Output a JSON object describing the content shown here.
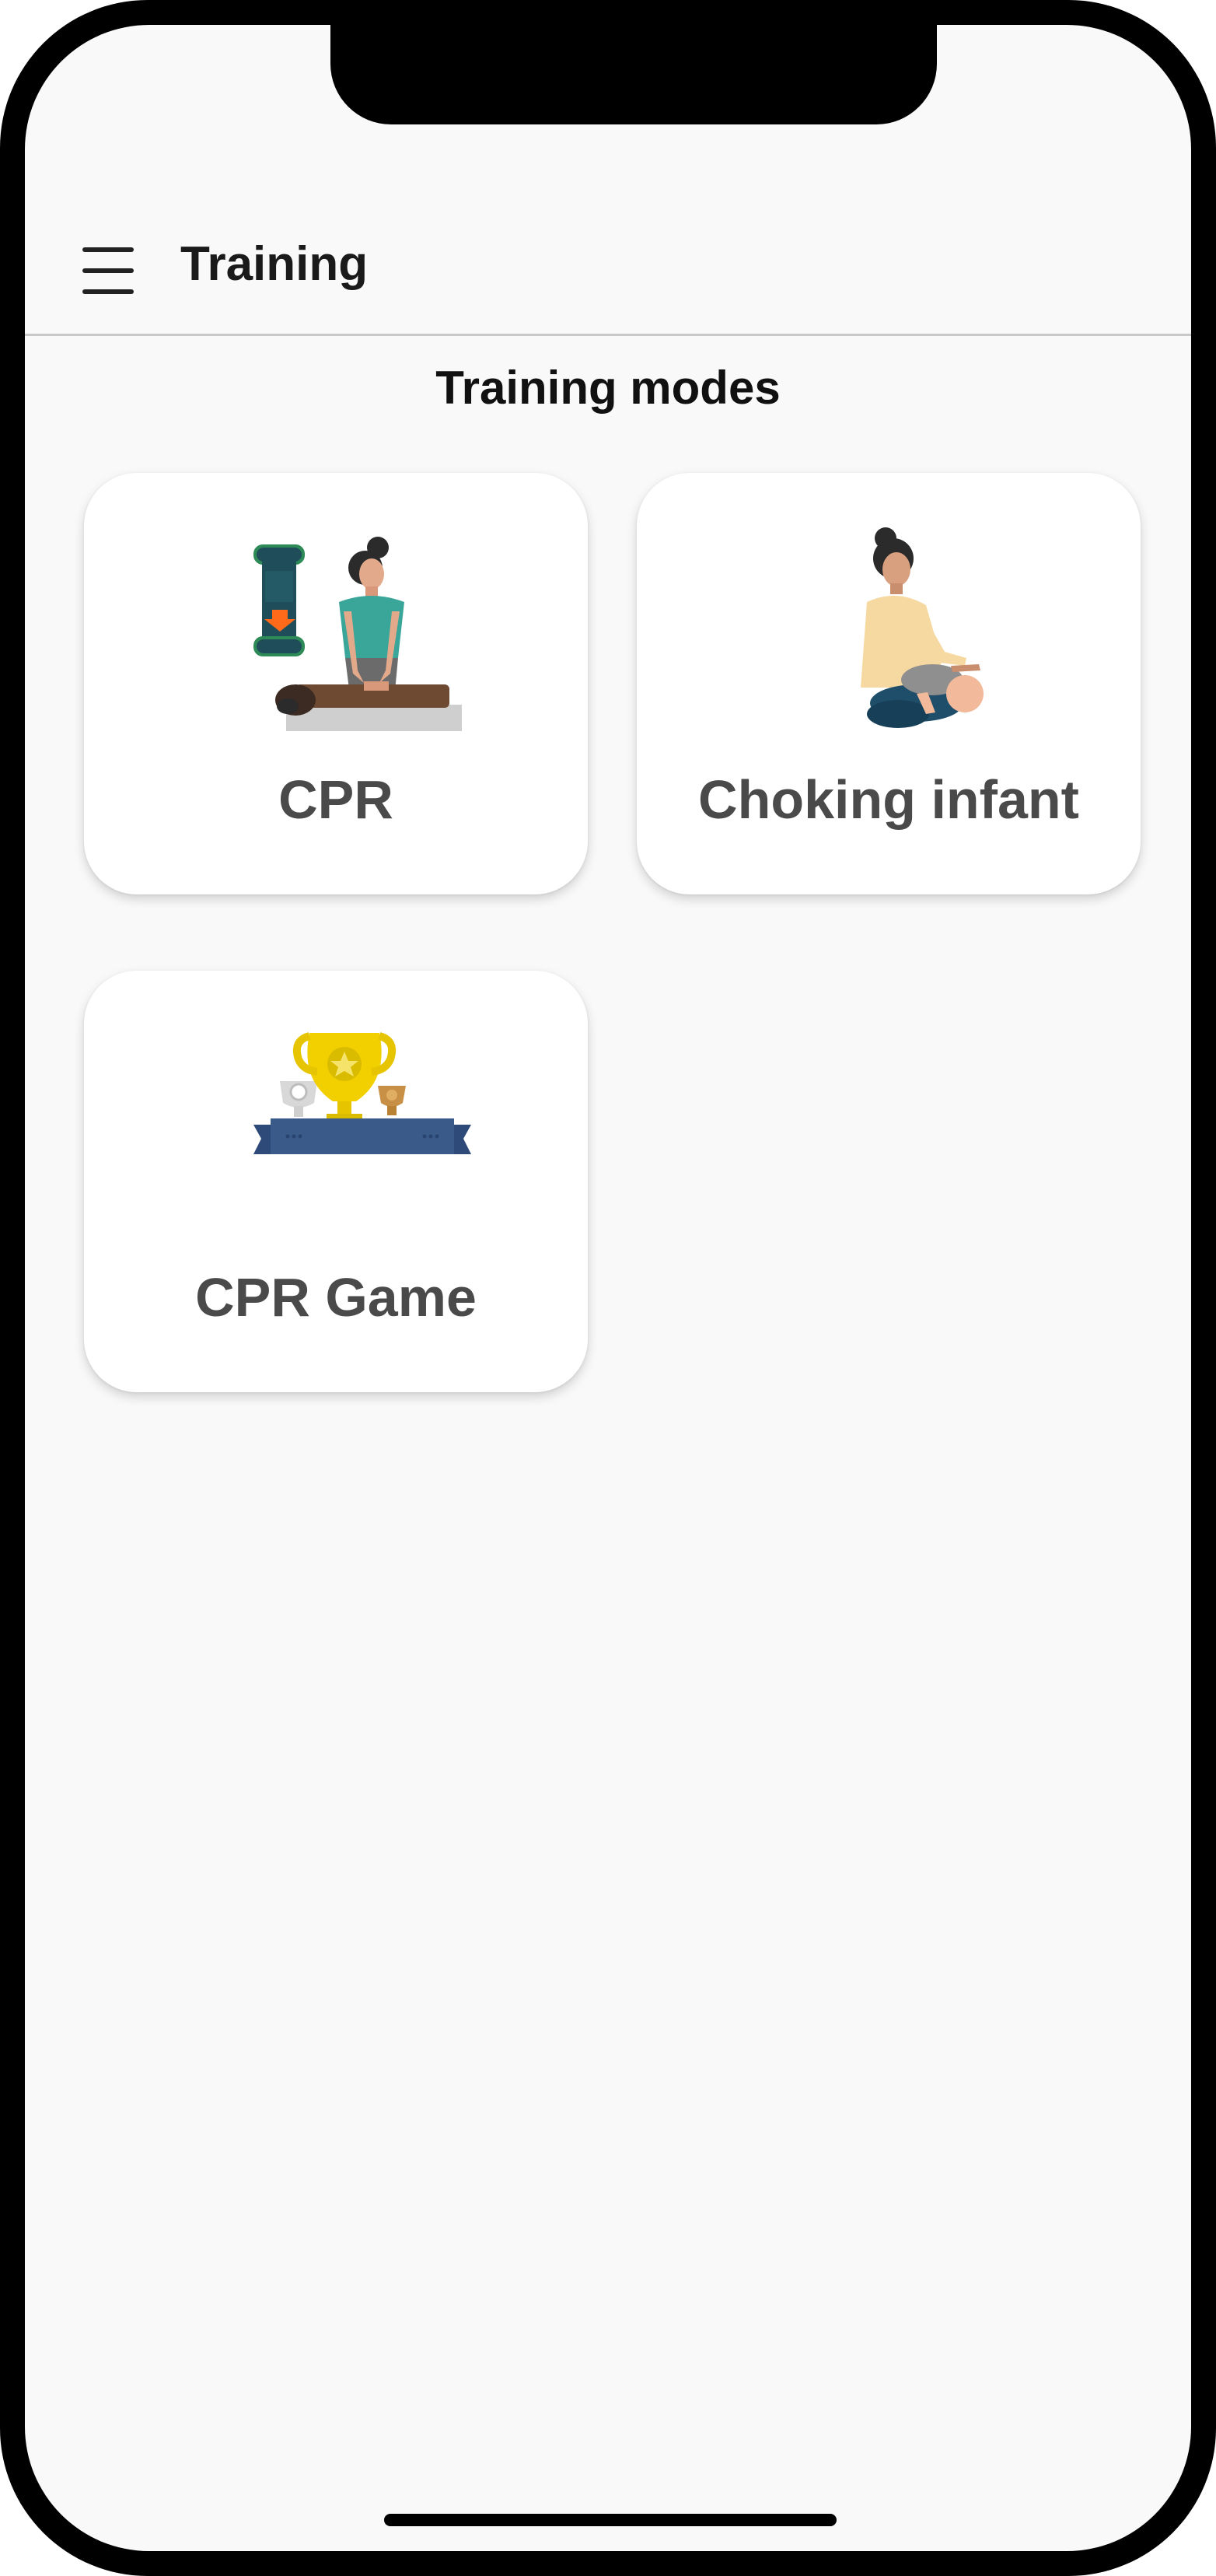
{
  "app_bar": {
    "title": "Training",
    "menu_icon": "hamburger-menu-icon"
  },
  "section": {
    "title": "Training modes"
  },
  "cards": [
    {
      "label": "CPR",
      "icon": "cpr-compression-illustration"
    },
    {
      "label": "Choking infant",
      "icon": "choking-infant-illustration"
    },
    {
      "label": "CPR Game",
      "icon": "trophy-podium-illustration"
    }
  ],
  "colors": {
    "screen_background": "#f9f9f9",
    "card_background": "#ffffff",
    "title_text": "#1a1a1a",
    "card_label_text": "#4a4a4a",
    "divider": "#c8c8c8"
  }
}
